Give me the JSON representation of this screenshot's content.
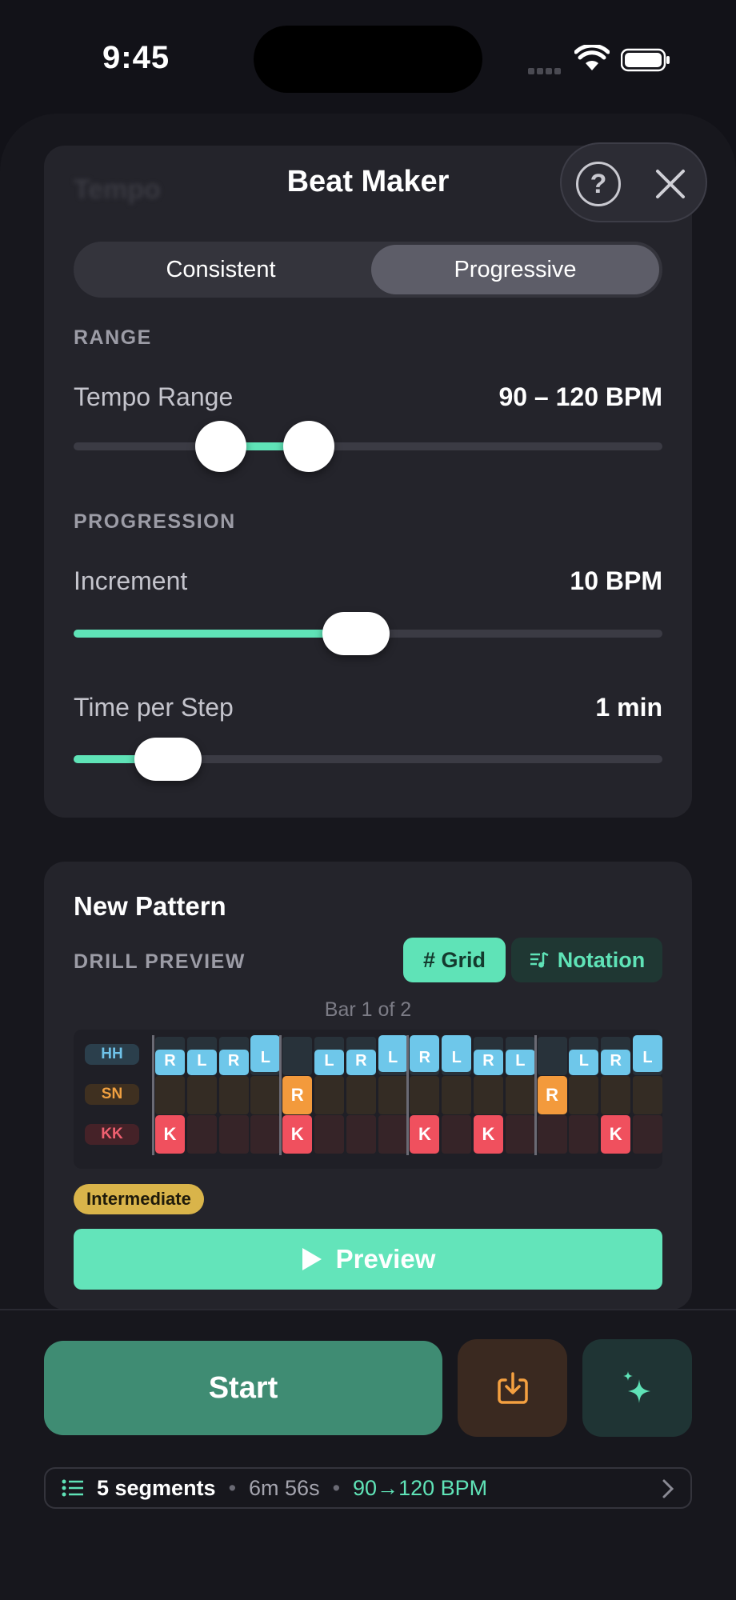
{
  "status": {
    "time": "9:45"
  },
  "header": {
    "ghost_title": "Tempo",
    "title": "Beat Maker",
    "help_glyph": "?"
  },
  "mode": {
    "options": [
      "Consistent",
      "Progressive"
    ],
    "selected": "Progressive"
  },
  "range": {
    "section": "RANGE",
    "label": "Tempo Range",
    "value": "90 – 120 BPM",
    "low_fraction": 0.25,
    "high_fraction": 0.4
  },
  "progression": {
    "section": "PROGRESSION",
    "increment_label": "Increment",
    "increment_value": "10 BPM",
    "increment_fraction": 0.48,
    "time_label": "Time per Step",
    "time_value": "1 min",
    "time_fraction": 0.16
  },
  "pattern": {
    "title": "New Pattern",
    "preview_label": "DRILL PREVIEW",
    "view_grid": "# Grid",
    "view_notation": "Notation",
    "bar_label": "Bar 1 of 2",
    "lanes": [
      "HH",
      "SN",
      "KK"
    ],
    "hh": [
      "R",
      "L",
      "R",
      "L",
      "",
      "L",
      "R",
      "L",
      "R",
      "L",
      "R",
      "L",
      "",
      "L",
      "R",
      "L"
    ],
    "hh_accent": [
      false,
      false,
      false,
      true,
      false,
      false,
      false,
      true,
      true,
      true,
      false,
      false,
      false,
      false,
      false,
      true
    ],
    "sn": [
      "",
      "",
      "",
      "",
      "R",
      "",
      "",
      "",
      "",
      "",
      "",
      "",
      "R",
      "",
      "",
      ""
    ],
    "kk": [
      "K",
      "",
      "",
      "",
      "K",
      "",
      "",
      "",
      "K",
      "",
      "K",
      "",
      "",
      "",
      "K",
      ""
    ],
    "level": "Intermediate",
    "preview_button": "Preview"
  },
  "actions": {
    "start": "Start"
  },
  "summary": {
    "segments": "5 segments",
    "duration": "6m 56s",
    "bpm": "90→120 BPM"
  },
  "colors": {
    "accent": "#5fe3b7",
    "hh": "#6ec7ea",
    "sn": "#f39a3c",
    "kk": "#f0505e"
  }
}
